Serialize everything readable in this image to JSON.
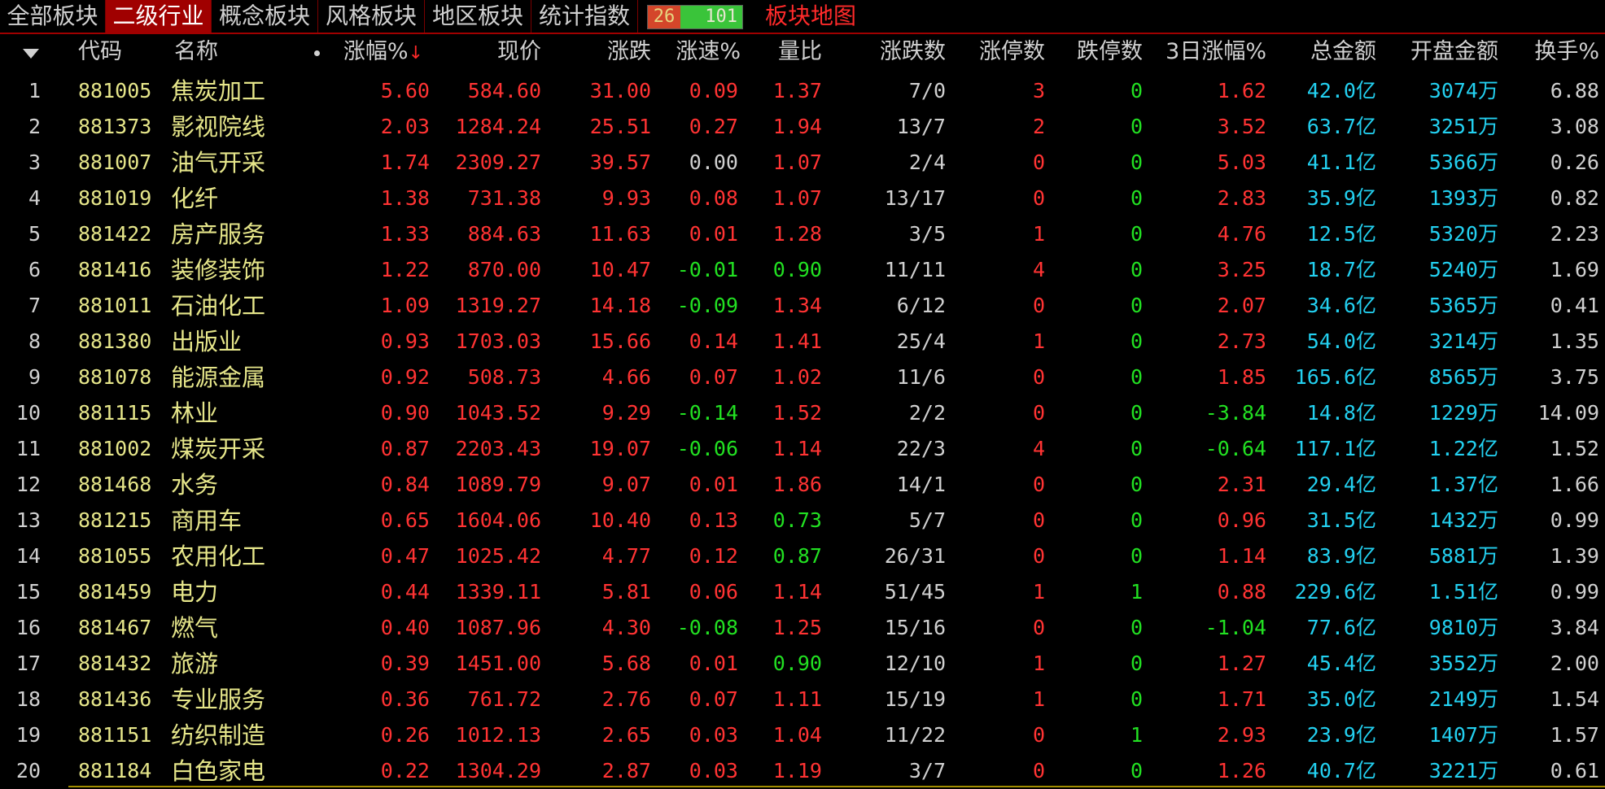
{
  "tabs": [
    {
      "label": "全部板块",
      "active": false
    },
    {
      "label": "二级行业",
      "active": true
    },
    {
      "label": "概念板块",
      "active": false
    },
    {
      "label": "风格板块",
      "active": false
    },
    {
      "label": "地区板块",
      "active": false
    },
    {
      "label": "统计指数",
      "active": false
    }
  ],
  "updown": {
    "up": "26",
    "down": "101"
  },
  "map_link": "板块地图",
  "columns": {
    "code": "代码",
    "name": "名称",
    "pct": "涨幅%",
    "price": "现价",
    "change": "涨跌",
    "speed": "涨速%",
    "vol_ratio": "量比",
    "updown": "涨跌数",
    "limit_up": "涨停数",
    "limit_down": "跌停数",
    "pct3d": "3日涨幅%",
    "amount": "总金额",
    "open_amount": "开盘金额",
    "turnover": "换手%"
  },
  "colors": {
    "up": "#ff3333",
    "down": "#22e022",
    "flat": "#d0d0d0",
    "amount": "#23d0f0",
    "name": "#e6e68a"
  },
  "rows": [
    {
      "idx": "1",
      "code": "881005",
      "name": "焦炭加工",
      "pct": "5.60",
      "price": "584.60",
      "change": "31.00",
      "speed": "0.09",
      "vol_ratio": "1.37",
      "updown": "7/0",
      "limit_up": "3",
      "limit_down": "0",
      "pct3d": "1.62",
      "amount": "42.0亿",
      "open_amount": "3074万",
      "turnover": "6.88"
    },
    {
      "idx": "2",
      "code": "881373",
      "name": "影视院线",
      "pct": "2.03",
      "price": "1284.24",
      "change": "25.51",
      "speed": "0.27",
      "vol_ratio": "1.94",
      "updown": "13/7",
      "limit_up": "2",
      "limit_down": "0",
      "pct3d": "3.52",
      "amount": "63.7亿",
      "open_amount": "3251万",
      "turnover": "3.08"
    },
    {
      "idx": "3",
      "code": "881007",
      "name": "油气开采",
      "pct": "1.74",
      "price": "2309.27",
      "change": "39.57",
      "speed": "0.00",
      "vol_ratio": "1.07",
      "updown": "2/4",
      "limit_up": "0",
      "limit_down": "0",
      "pct3d": "5.03",
      "amount": "41.1亿",
      "open_amount": "5366万",
      "turnover": "0.26"
    },
    {
      "idx": "4",
      "code": "881019",
      "name": "化纤",
      "pct": "1.38",
      "price": "731.38",
      "change": "9.93",
      "speed": "0.08",
      "vol_ratio": "1.07",
      "updown": "13/17",
      "limit_up": "0",
      "limit_down": "0",
      "pct3d": "2.83",
      "amount": "35.9亿",
      "open_amount": "1393万",
      "turnover": "0.82"
    },
    {
      "idx": "5",
      "code": "881422",
      "name": "房产服务",
      "pct": "1.33",
      "price": "884.63",
      "change": "11.63",
      "speed": "0.01",
      "vol_ratio": "1.28",
      "updown": "3/5",
      "limit_up": "1",
      "limit_down": "0",
      "pct3d": "4.76",
      "amount": "12.5亿",
      "open_amount": "5320万",
      "turnover": "2.23"
    },
    {
      "idx": "6",
      "code": "881416",
      "name": "装修装饰",
      "pct": "1.22",
      "price": "870.00",
      "change": "10.47",
      "speed": "-0.01",
      "vol_ratio": "0.90",
      "updown": "11/11",
      "limit_up": "4",
      "limit_down": "0",
      "pct3d": "3.25",
      "amount": "18.7亿",
      "open_amount": "5240万",
      "turnover": "1.69"
    },
    {
      "idx": "7",
      "code": "881011",
      "name": "石油化工",
      "pct": "1.09",
      "price": "1319.27",
      "change": "14.18",
      "speed": "-0.09",
      "vol_ratio": "1.34",
      "updown": "6/12",
      "limit_up": "0",
      "limit_down": "0",
      "pct3d": "2.07",
      "amount": "34.6亿",
      "open_amount": "5365万",
      "turnover": "0.41"
    },
    {
      "idx": "8",
      "code": "881380",
      "name": "出版业",
      "pct": "0.93",
      "price": "1703.03",
      "change": "15.66",
      "speed": "0.14",
      "vol_ratio": "1.41",
      "updown": "25/4",
      "limit_up": "1",
      "limit_down": "0",
      "pct3d": "2.73",
      "amount": "54.0亿",
      "open_amount": "3214万",
      "turnover": "1.35"
    },
    {
      "idx": "9",
      "code": "881078",
      "name": "能源金属",
      "pct": "0.92",
      "price": "508.73",
      "change": "4.66",
      "speed": "0.07",
      "vol_ratio": "1.02",
      "updown": "11/6",
      "limit_up": "0",
      "limit_down": "0",
      "pct3d": "1.85",
      "amount": "165.6亿",
      "open_amount": "8565万",
      "turnover": "3.75"
    },
    {
      "idx": "10",
      "code": "881115",
      "name": "林业",
      "pct": "0.90",
      "price": "1043.52",
      "change": "9.29",
      "speed": "-0.14",
      "vol_ratio": "1.52",
      "updown": "2/2",
      "limit_up": "0",
      "limit_down": "0",
      "pct3d": "-3.84",
      "amount": "14.8亿",
      "open_amount": "1229万",
      "turnover": "14.09"
    },
    {
      "idx": "11",
      "code": "881002",
      "name": "煤炭开采",
      "pct": "0.87",
      "price": "2203.43",
      "change": "19.07",
      "speed": "-0.06",
      "vol_ratio": "1.14",
      "updown": "22/3",
      "limit_up": "4",
      "limit_down": "0",
      "pct3d": "-0.64",
      "amount": "117.1亿",
      "open_amount": "1.22亿",
      "turnover": "1.52"
    },
    {
      "idx": "12",
      "code": "881468",
      "name": "水务",
      "pct": "0.84",
      "price": "1089.79",
      "change": "9.07",
      "speed": "0.01",
      "vol_ratio": "1.86",
      "updown": "14/1",
      "limit_up": "0",
      "limit_down": "0",
      "pct3d": "2.31",
      "amount": "29.4亿",
      "open_amount": "1.37亿",
      "turnover": "1.66"
    },
    {
      "idx": "13",
      "code": "881215",
      "name": "商用车",
      "pct": "0.65",
      "price": "1604.06",
      "change": "10.40",
      "speed": "0.13",
      "vol_ratio": "0.73",
      "updown": "5/7",
      "limit_up": "0",
      "limit_down": "0",
      "pct3d": "0.96",
      "amount": "31.5亿",
      "open_amount": "1432万",
      "turnover": "0.99"
    },
    {
      "idx": "14",
      "code": "881055",
      "name": "农用化工",
      "pct": "0.47",
      "price": "1025.42",
      "change": "4.77",
      "speed": "0.12",
      "vol_ratio": "0.87",
      "updown": "26/31",
      "limit_up": "0",
      "limit_down": "0",
      "pct3d": "1.14",
      "amount": "83.9亿",
      "open_amount": "5881万",
      "turnover": "1.39"
    },
    {
      "idx": "15",
      "code": "881459",
      "name": "电力",
      "pct": "0.44",
      "price": "1339.11",
      "change": "5.81",
      "speed": "0.06",
      "vol_ratio": "1.14",
      "updown": "51/45",
      "limit_up": "1",
      "limit_down": "1",
      "pct3d": "0.88",
      "amount": "229.6亿",
      "open_amount": "1.51亿",
      "turnover": "0.99"
    },
    {
      "idx": "16",
      "code": "881467",
      "name": "燃气",
      "pct": "0.40",
      "price": "1087.96",
      "change": "4.30",
      "speed": "-0.08",
      "vol_ratio": "1.25",
      "updown": "15/16",
      "limit_up": "0",
      "limit_down": "0",
      "pct3d": "-1.04",
      "amount": "77.6亿",
      "open_amount": "9810万",
      "turnover": "3.84"
    },
    {
      "idx": "17",
      "code": "881432",
      "name": "旅游",
      "pct": "0.39",
      "price": "1451.00",
      "change": "5.68",
      "speed": "0.01",
      "vol_ratio": "0.90",
      "updown": "12/10",
      "limit_up": "1",
      "limit_down": "0",
      "pct3d": "1.27",
      "amount": "45.4亿",
      "open_amount": "3552万",
      "turnover": "2.00"
    },
    {
      "idx": "18",
      "code": "881436",
      "name": "专业服务",
      "pct": "0.36",
      "price": "761.72",
      "change": "2.76",
      "speed": "0.07",
      "vol_ratio": "1.11",
      "updown": "15/19",
      "limit_up": "1",
      "limit_down": "0",
      "pct3d": "1.71",
      "amount": "35.0亿",
      "open_amount": "2149万",
      "turnover": "1.54"
    },
    {
      "idx": "19",
      "code": "881151",
      "name": "纺织制造",
      "pct": "0.26",
      "price": "1012.13",
      "change": "2.65",
      "speed": "0.03",
      "vol_ratio": "1.04",
      "updown": "11/22",
      "limit_up": "0",
      "limit_down": "1",
      "pct3d": "2.93",
      "amount": "23.9亿",
      "open_amount": "1407万",
      "turnover": "1.57"
    },
    {
      "idx": "20",
      "code": "881184",
      "name": "白色家电",
      "pct": "0.22",
      "price": "1304.29",
      "change": "2.87",
      "speed": "0.03",
      "vol_ratio": "1.19",
      "updown": "3/7",
      "limit_up": "0",
      "limit_down": "0",
      "pct3d": "1.26",
      "amount": "40.7亿",
      "open_amount": "3221万",
      "turnover": "0.61"
    }
  ]
}
